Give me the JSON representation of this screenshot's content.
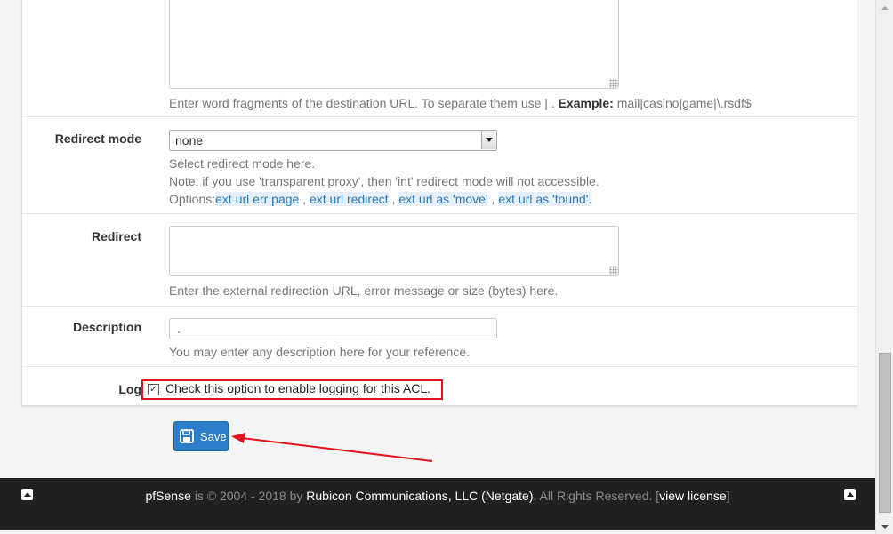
{
  "destination_url": {
    "help_text": "Enter word fragments of the destination URL. To separate them use | . ",
    "help_example_label": "Example:",
    "help_example_value": " mail|casino|game|\\.rsdf$"
  },
  "redirect_mode": {
    "label": "Redirect mode",
    "selected": "none",
    "help_line1": "Select redirect mode here.",
    "help_line2": "Note: if you use 'transparent proxy', then 'int' redirect mode will not accessible.",
    "options_prefix": "Options:",
    "options": [
      "ext url err page",
      "ext url redirect",
      "ext url as 'move'",
      "ext url as 'found'."
    ],
    "option_separator": " , "
  },
  "redirect": {
    "label": "Redirect",
    "value": "",
    "help": "Enter the external redirection URL, error message or size (bytes) here."
  },
  "description": {
    "label": "Description",
    "value": ".",
    "help": "You may enter any description here for your reference."
  },
  "log": {
    "label": "Log",
    "checked": true,
    "checkbox_label": "Check this option to enable logging for this ACL."
  },
  "save_button": {
    "label": "Save",
    "icon": "save-icon"
  },
  "footer": {
    "brand": "pfSense",
    "copyright_mid": " is © 2004 - 2018 by ",
    "company": "Rubicon Communications, LLC (Netgate)",
    "rights": ". All Rights Reserved. [",
    "license_link": "view license",
    "close_bracket": "]"
  },
  "colors": {
    "accent": "#2a7dc9",
    "highlight_box": "#e0141e",
    "arrow": "#e0141e",
    "footer_bg": "#212121"
  }
}
